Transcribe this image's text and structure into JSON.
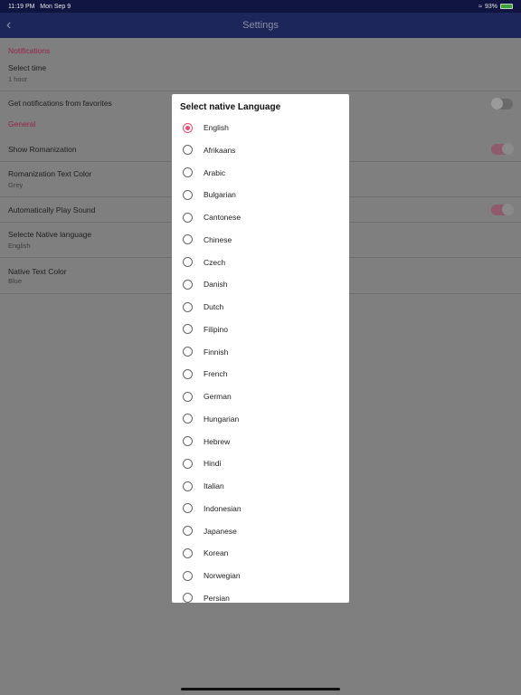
{
  "status": {
    "time": "11:19 PM",
    "date": "Mon Sep 9",
    "battery": "93%"
  },
  "header": {
    "title": "Settings",
    "back_icon": "chevron-left"
  },
  "settings": {
    "notifications_header": "Notifications",
    "select_time": {
      "label": "Select time",
      "value": "1 hour"
    },
    "favorites": {
      "label": "Get notifications from favorites",
      "on": false
    },
    "general_header": "General",
    "show_romanization": {
      "label": "Show Romanization",
      "on": true
    },
    "romanization_color": {
      "label": "Romanization Text Color",
      "value": "Grey"
    },
    "auto_play": {
      "label": "Automatically Play Sound",
      "on": true
    },
    "native_language": {
      "label": "Selecte Native language",
      "value": "English"
    },
    "native_color": {
      "label": "Native Text Color",
      "value": "Blue"
    }
  },
  "dialog": {
    "title": "Select native Language",
    "selected": "English",
    "accent": "#e84a78",
    "options": [
      "English",
      "Afrikaans",
      "Arabic",
      "Bulgarian",
      "Cantonese",
      "Chinese",
      "Czech",
      "Danish",
      "Dutch",
      "Filipino",
      "Finnish",
      "French",
      "German",
      "Hungarian",
      "Hebrew",
      "Hindi",
      "Italian",
      "Indonesian",
      "Japanese",
      "Korean",
      "Norwegian",
      "Persian"
    ]
  }
}
